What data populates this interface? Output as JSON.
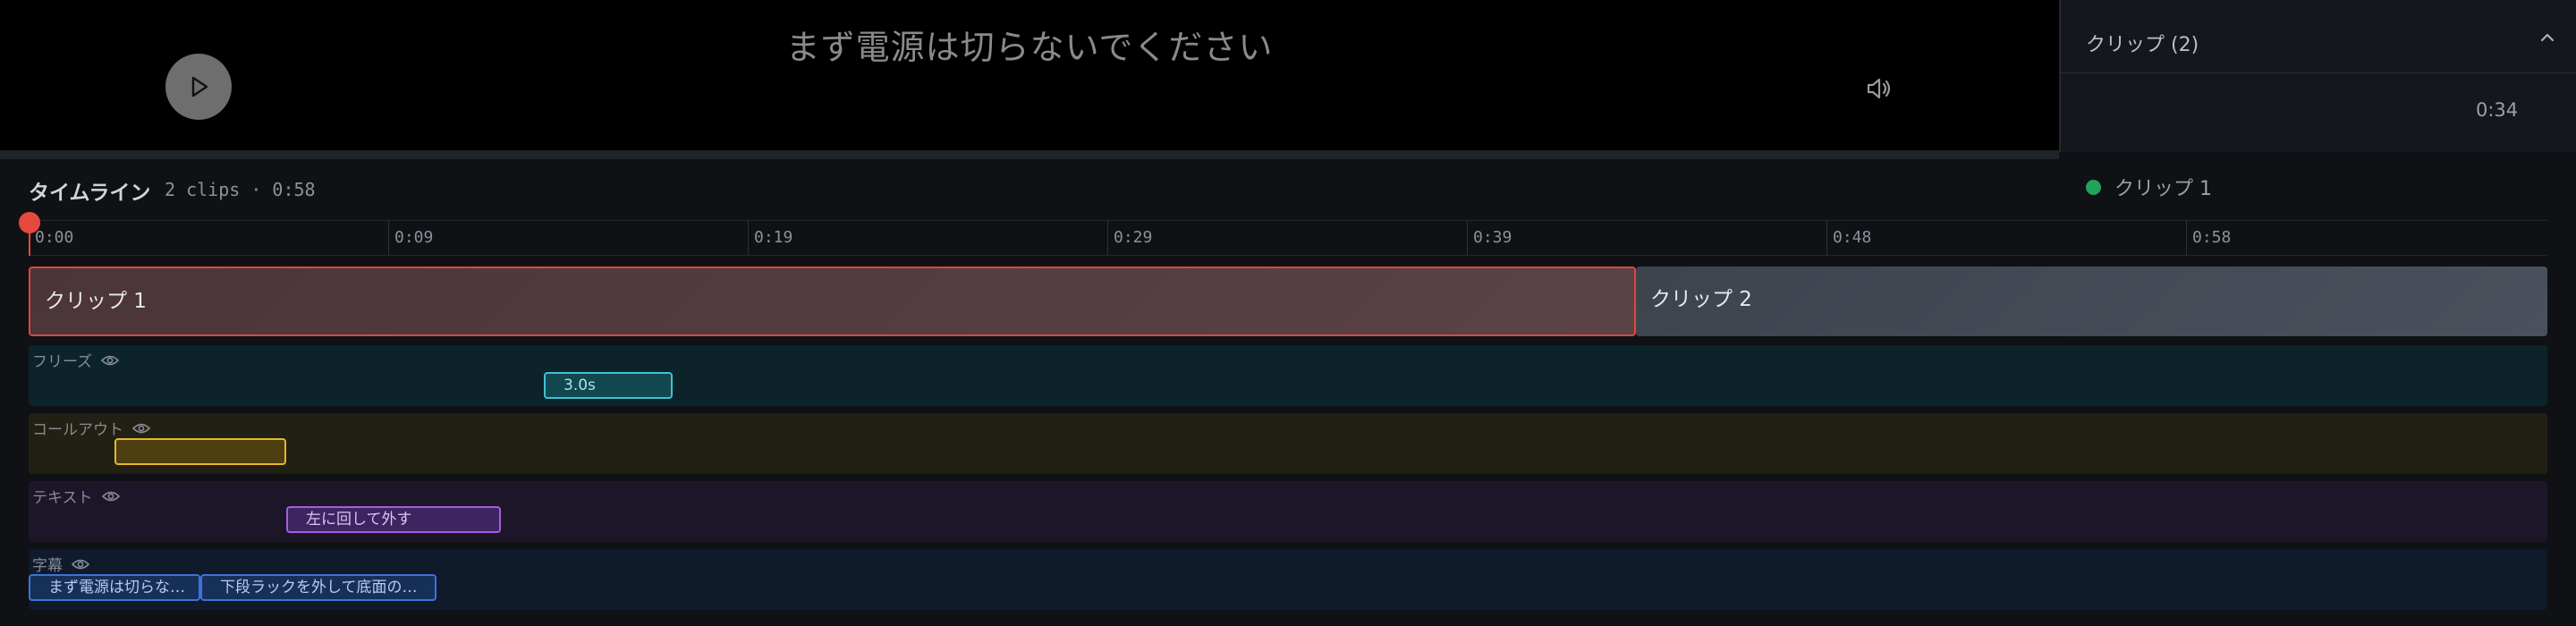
{
  "player": {
    "subtitle": "まず電源は切らないでください"
  },
  "panel": {
    "title": "クリップ (2)",
    "items": [
      {
        "label": "クリップ 1",
        "time": "0:34",
        "status_color": "#22a35a"
      }
    ]
  },
  "timeline": {
    "title": "タイムライン",
    "meta": "2 clips · 0:58",
    "ticks": [
      "0:00",
      "0:09",
      "0:19",
      "0:29",
      "0:39",
      "0:48",
      "0:58"
    ],
    "clips": [
      {
        "label": "クリップ 1",
        "selected": true
      },
      {
        "label": "クリップ 2",
        "selected": false
      }
    ],
    "lanes": {
      "freeze": {
        "label": "フリーズ",
        "chips": [
          "3.0s"
        ]
      },
      "callout": {
        "label": "コールアウト",
        "chips": [
          ""
        ]
      },
      "text": {
        "label": "テキスト",
        "chips": [
          "左に回して外す"
        ]
      },
      "subtitles": {
        "label": "字幕",
        "chips": [
          "まず電源は切らな…",
          "下段ラックを外して底面の…"
        ]
      }
    }
  },
  "colors": {
    "accent": "#e64a3e",
    "freeze": "#3cc4d4",
    "callout": "#e8b52a",
    "text": "#a35ee0",
    "subtitles": "#3f73d8"
  },
  "icons": [
    "play-icon",
    "volume-icon",
    "chevron-up-icon",
    "eye-icon"
  ]
}
